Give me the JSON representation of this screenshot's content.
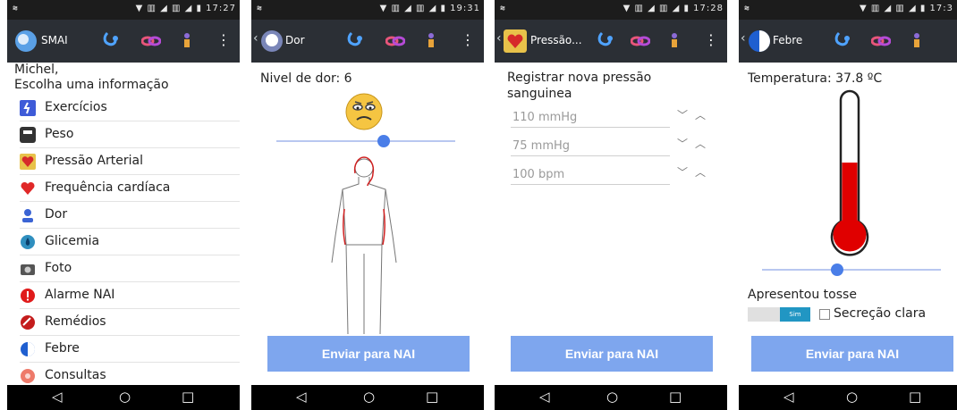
{
  "screens": [
    {
      "status": {
        "time": "17:27"
      },
      "appbar": {
        "title": "SMAI"
      },
      "greeting": {
        "line1": "Michel,",
        "line2": "Escolha uma informação"
      },
      "menu": [
        {
          "label": "Exercícios",
          "icon": "exercise-icon"
        },
        {
          "label": "Peso",
          "icon": "scale-icon"
        },
        {
          "label": "Pressão Arterial",
          "icon": "blood-pressure-icon"
        },
        {
          "label": "Frequência cardíaca",
          "icon": "heart-icon"
        },
        {
          "label": "Dor",
          "icon": "person-icon"
        },
        {
          "label": "Glicemia",
          "icon": "drop-icon"
        },
        {
          "label": "Foto",
          "icon": "camera-icon"
        },
        {
          "label": "Alarme NAI",
          "icon": "alarm-icon"
        },
        {
          "label": "Remédios",
          "icon": "pill-icon"
        },
        {
          "label": "Febre",
          "icon": "thermometer-icon"
        },
        {
          "label": "Consultas",
          "icon": "appointment-icon"
        }
      ]
    },
    {
      "status": {
        "time": "19:31"
      },
      "appbar": {
        "title": "Dor"
      },
      "pain": {
        "label": "Nivel de dor: 6",
        "level": 6,
        "max": 10
      },
      "send_label": "Enviar para NAI"
    },
    {
      "status": {
        "time": "17:28"
      },
      "appbar": {
        "title": "Pressão..."
      },
      "bp": {
        "title": "Registrar nova pressão sanguinea",
        "fields": [
          "110 mmHg",
          "75 mmHg",
          "100 bpm"
        ]
      },
      "send_label": "Enviar para NAI"
    },
    {
      "status": {
        "time": "17:3"
      },
      "appbar": {
        "title": "Febre"
      },
      "fever": {
        "temperature_label": "Temperatura: 37.8 ºC",
        "slider_level": 0.42,
        "cough_label": "Apresentou tosse",
        "toggle_label": "Sim",
        "secretion_label": "Secreção clara"
      },
      "send_label": "Enviar para NAI"
    }
  ],
  "nav": {
    "back": "◁",
    "home": "○",
    "recents": "□"
  },
  "colors": {
    "appbar": "#2b2f35",
    "button": "#7ea6ee",
    "accent": "#4a7ee8",
    "thermo_red": "#e00000"
  }
}
